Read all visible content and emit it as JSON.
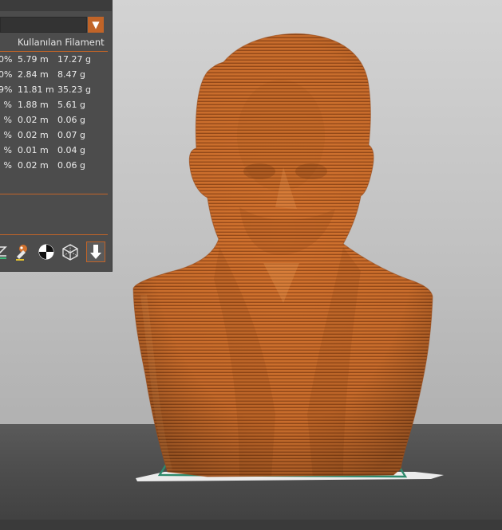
{
  "panel": {
    "column_header": "Kullanılan Filament",
    "dropdown_arrow": "▼",
    "rows": [
      {
        "pct": "0%",
        "length": "5.79 m",
        "weight": "17.27 g"
      },
      {
        "pct": "0%",
        "length": "2.84 m",
        "weight": "8.47 g"
      },
      {
        "pct": "9%",
        "length": "11.81 m",
        "weight": "35.23 g"
      },
      {
        "pct": "%",
        "length": "1.88 m",
        "weight": "5.61 g"
      },
      {
        "pct": "%",
        "length": "0.02 m",
        "weight": "0.06 g"
      },
      {
        "pct": "%",
        "length": "0.02 m",
        "weight": "0.07 g"
      },
      {
        "pct": "%",
        "length": "0.01 m",
        "weight": "0.04 g"
      },
      {
        "pct": "%",
        "length": "0.02 m",
        "weight": "0.06 g"
      }
    ],
    "toolbar": [
      "view-z-icon",
      "paint-icon",
      "center-target-icon",
      "wireframe-cube-icon",
      "download-icon"
    ]
  },
  "colors": {
    "accent": "#c16428",
    "model": "#d2722e",
    "panel_bg": "#4c4c4c",
    "bed_outline": "#2e8a6c"
  }
}
